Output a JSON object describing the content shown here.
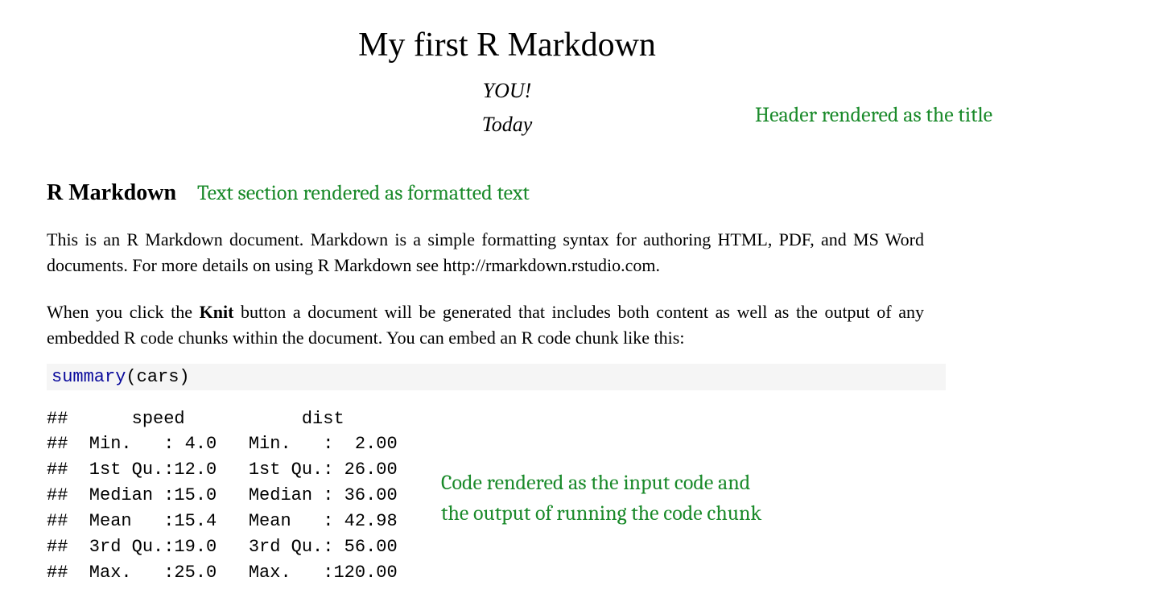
{
  "title": "My first R Markdown",
  "author": "YOU!",
  "date": "Today",
  "section_heading": "R Markdown",
  "para1": "This is an R Markdown document. Markdown is a simple formatting syntax for authoring HTML, PDF, and MS Word documents. For more details on using R Markdown see http://rmarkdown.rstudio.com.",
  "para2_pre": "When you click the ",
  "para2_bold": "Knit",
  "para2_post": " button a document will be generated that includes both content as well as the output of any embedded R code chunks within the document. You can embed an R code chunk like this:",
  "code_input_kw": "summary",
  "code_input_rest": "(cars)",
  "code_output": "##      speed           dist\n##  Min.   : 4.0   Min.   :  2.00\n##  1st Qu.:12.0   1st Qu.: 26.00\n##  Median :15.0   Median : 36.00\n##  Mean   :15.4   Mean   : 42.98\n##  3rd Qu.:19.0   3rd Qu.: 56.00\n##  Max.   :25.0   Max.   :120.00",
  "annotations": {
    "title": "Header rendered as the title",
    "text": "Text section rendered as formatted text",
    "code_line1": "Code rendered as the input code and",
    "code_line2": "the output of running the code chunk"
  }
}
